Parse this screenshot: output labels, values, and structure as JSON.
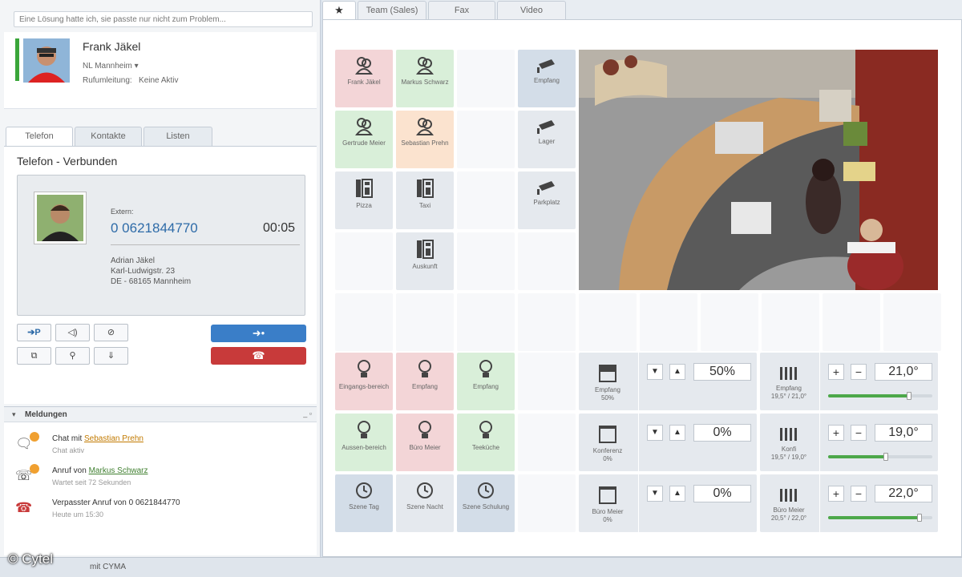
{
  "left": {
    "search_placeholder": "Eine Lösung hatte ich, sie passte nur nicht zum Problem...",
    "profile": {
      "name": "Frank Jäkel",
      "location": "NL Mannheim",
      "forward_label": "Rufumleitung:",
      "forward_value": "Keine Aktiv"
    },
    "tabs": [
      "Telefon",
      "Kontakte",
      "Listen"
    ],
    "phone_status": "Telefon - Verbunden",
    "call": {
      "type": "Extern:",
      "number": "0 0621844770",
      "duration": "00:05",
      "address": [
        "Adrian Jäkel",
        "Karl-Ludwigstr. 23",
        "DE - 68165 Mannheim"
      ]
    },
    "park_label": "➔P",
    "messages_title": "Meldungen",
    "messages": [
      {
        "prefix": "Chat mit ",
        "link": "Sebastian Prehn",
        "sub": "Chat aktiv"
      },
      {
        "prefix": "Anruf von ",
        "link": "Markus Schwarz",
        "sub": "Wartet seit 72 Sekunden"
      },
      {
        "prefix": "Verpasster Anruf von 0 0621844770",
        "link": "",
        "sub": "Heute um 15:30"
      }
    ]
  },
  "status_bar": "mit CYMA",
  "watermark": "© Cytel",
  "right": {
    "tabs": [
      "Team (Sales)",
      "Fax",
      "Video"
    ],
    "contacts": [
      {
        "label": "Frank Jäkel",
        "color": "red"
      },
      {
        "label": "Markus Schwarz",
        "color": "green"
      },
      {
        "label": "Gertrude Meier",
        "color": "green"
      },
      {
        "label": "Sebastian Prehn",
        "color": "orange"
      }
    ],
    "phones": [
      "Pizza",
      "Taxi",
      "Auskunft"
    ],
    "cameras": [
      "Empfang",
      "Lager",
      "Parkplatz"
    ],
    "lights": [
      {
        "label": "Eingangs-bereich",
        "color": "red"
      },
      {
        "label": "Empfang",
        "color": "red"
      },
      {
        "label": "Empfang",
        "color": "green"
      },
      {
        "label": "Aussen-bereich",
        "color": "green"
      },
      {
        "label": "Büro Meier",
        "color": "red"
      },
      {
        "label": "Teeküche",
        "color": "green"
      }
    ],
    "scenes": [
      {
        "label": "Szene Tag",
        "color": "blue"
      },
      {
        "label": "Szene Nacht",
        "color": "gray"
      },
      {
        "label": "Szene Schulung",
        "color": "blue"
      }
    ],
    "blinds": [
      {
        "name": "Empfang",
        "level_text": "50%",
        "value": "50%"
      },
      {
        "name": "Konferenz",
        "level_text": "0%",
        "value": "0%"
      },
      {
        "name": "Büro Meier",
        "level_text": "0%",
        "value": "0%"
      }
    ],
    "heating": [
      {
        "name": "Empfang",
        "temps": "19,5° / 21,0°",
        "value": "21,0°",
        "level": 0.78
      },
      {
        "name": "Konfi",
        "temps": "19,5° / 19,0°",
        "value": "19,0°",
        "level": 0.55
      },
      {
        "name": "Büro Meier",
        "temps": "20,5° / 22,0°",
        "value": "22,0°",
        "level": 0.88
      }
    ]
  },
  "colors": {
    "red": "#f3d5d7",
    "green": "#d9efd9",
    "orange": "#fbe3cf",
    "blue": "#d3dde8",
    "gray": "#e5e9ee",
    "accept": "#3a7ec8",
    "reject": "#c83a3a"
  }
}
